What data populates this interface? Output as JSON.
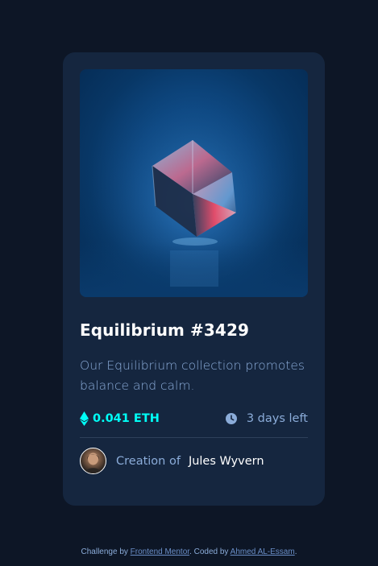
{
  "card": {
    "title": "Equilibrium #3429",
    "description": "Our Equilibrium collection promotes balance and calm.",
    "price": "0.041 ETH",
    "time_left": "3 days left",
    "creator_label": "Creation of",
    "creator_name": "Jules Wyvern",
    "image_icon": "crystal-cube-image",
    "price_icon": "ethereum-icon",
    "time_icon": "clock-icon"
  },
  "attribution": {
    "prefix": "Challenge by",
    "challenge_link": "Frontend Mentor",
    "middle": ". Coded by",
    "author_link": "Ahmed AL-Essam",
    "suffix": "."
  },
  "colors": {
    "page_bg": "#0d1626",
    "card_bg": "#15263f",
    "accent_cyan": "#00fff7",
    "soft_blue": "#8bacd9",
    "divider": "#2e405a",
    "white": "#ffffff"
  }
}
